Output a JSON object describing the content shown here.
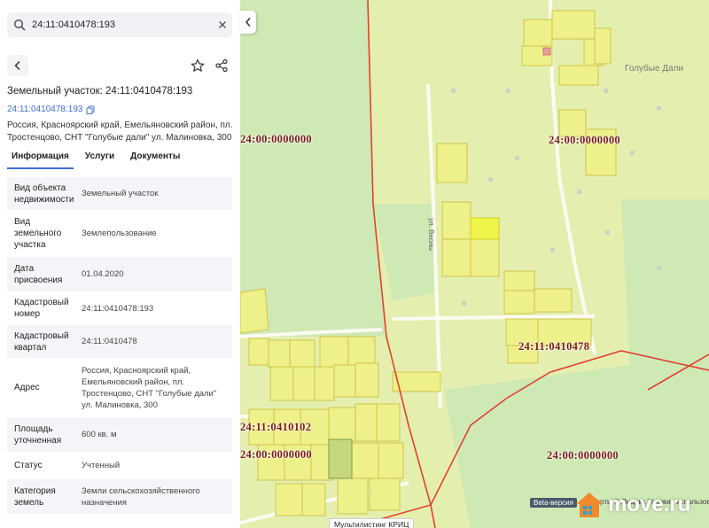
{
  "search": {
    "value": "24:11:0410478:193"
  },
  "header": {
    "title": "Земельный участок: 24:11:0410478:193",
    "cadastral_link": "24:11:0410478:193",
    "address": "Россия, Красноярский край, Емельяновский район, пл. Тростенцово, СНТ \"Голубые дали\" ул. Малиновка, 300"
  },
  "tabs": [
    {
      "label": "Информация",
      "active": true
    },
    {
      "label": "Услуги",
      "active": false
    },
    {
      "label": "Документы",
      "active": false
    }
  ],
  "info_rows": [
    {
      "key": "Вид объекта недвижимости",
      "value": "Земельный участок"
    },
    {
      "key": "Вид земельного участка",
      "value": "Землепользование"
    },
    {
      "key": "Дата присвоения",
      "value": "01.04.2020"
    },
    {
      "key": "Кадастровый номер",
      "value": "24:11:0410478:193"
    },
    {
      "key": "Кадастровый квартал",
      "value": "24:11:0410478"
    },
    {
      "key": "Адрес",
      "value": "Россия, Красноярский край, Емельяновский район, пл. Тростенцово, СНТ \"Голубые дали\" ул. Малиновка, 300"
    },
    {
      "key": "Площадь уточненная",
      "value": "600 кв. м"
    },
    {
      "key": "Статус",
      "value": "Учтенный"
    },
    {
      "key": "Категория земель",
      "value": "Земли сельскохозяйственного назначения"
    }
  ],
  "map": {
    "quarter_labels": [
      "24:00:0000000",
      "24:00:0000000",
      "24:11:0410478",
      "24:11:0410102",
      "24:00:0000000",
      "24:00:0000000"
    ],
    "place_label": "Голубые Дали",
    "street_label": "ул. Весны",
    "beta_label": "Beta-версия",
    "yandex_attribution": "Карты © Яндекс  Условия использования",
    "multilisting_label": "Мультилистинг КРИЦ",
    "logo_text": "move.ru"
  },
  "colors": {
    "accent": "#3b6fd6",
    "map_background": "#e4efaf",
    "parcel_fill": "#eef089",
    "parcel_border": "#cfc44a",
    "boundary": "#e0412f",
    "forest": "#cfe9b5",
    "quarter_label": "#7a1c1c"
  },
  "icons": {
    "search": "search-icon",
    "clear": "close-icon",
    "back": "chevron-left-icon",
    "favorite": "star-icon",
    "share": "share-icon",
    "copy": "copy-icon",
    "collapse": "chevron-left-icon",
    "logo": "house-icon"
  }
}
